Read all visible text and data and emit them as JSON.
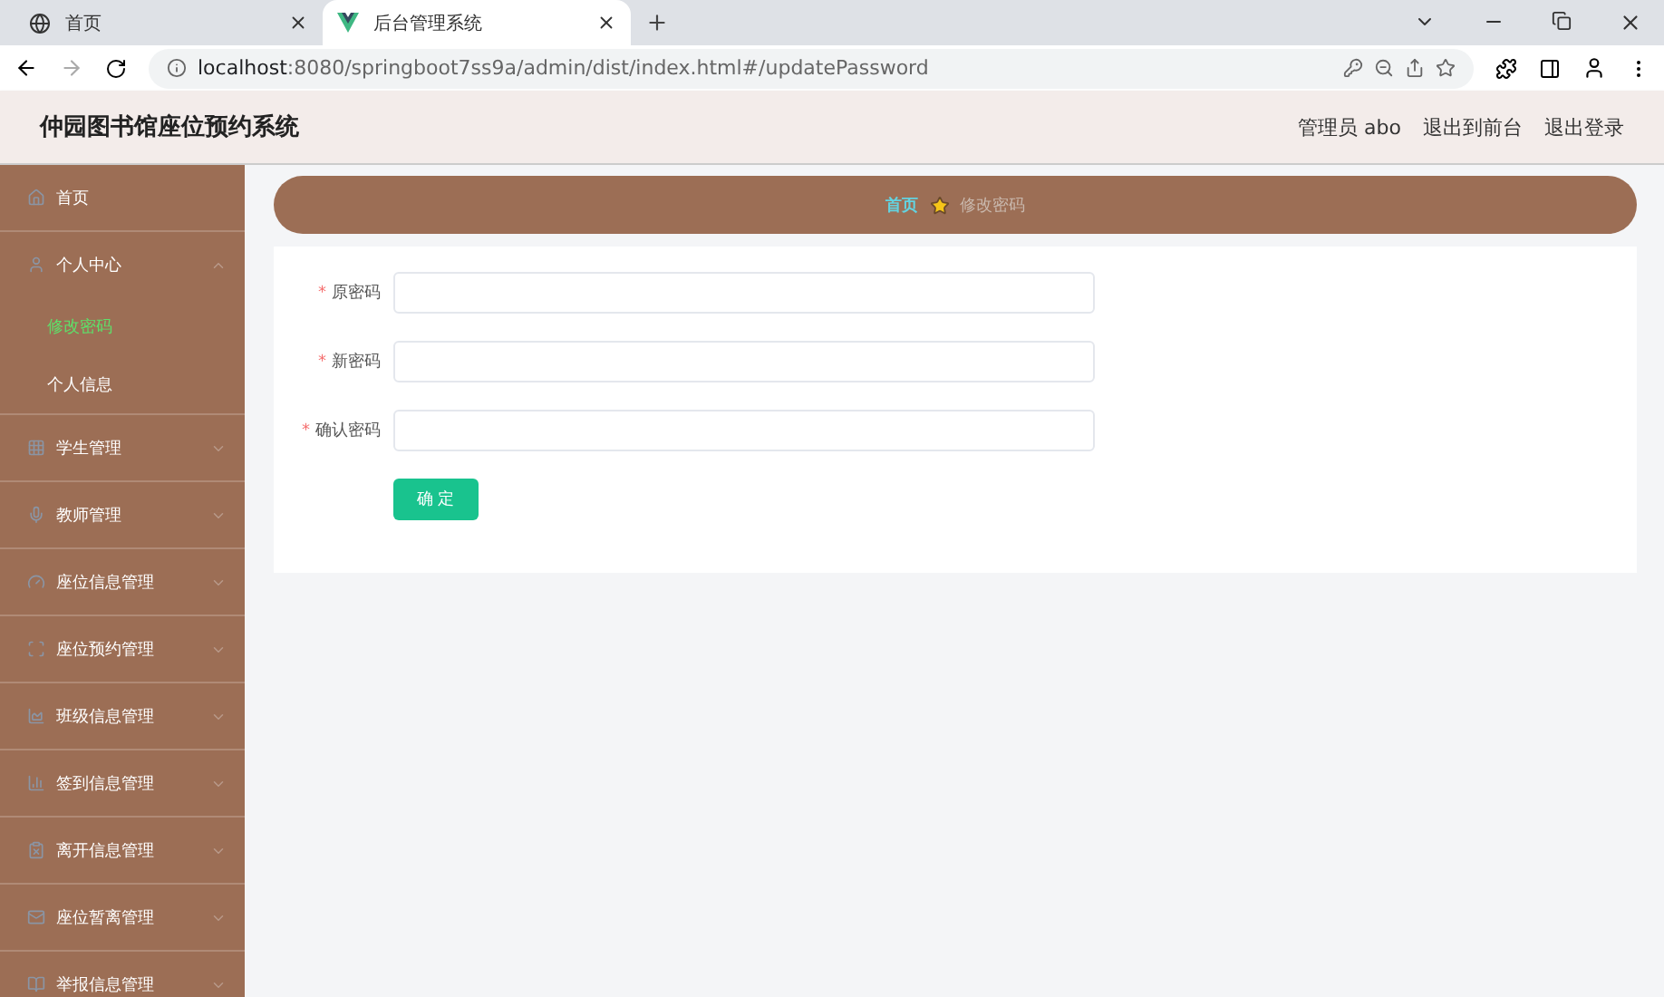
{
  "browser": {
    "tabs": [
      {
        "title": "首页",
        "selected": false
      },
      {
        "title": "后台管理系统",
        "selected": true
      }
    ],
    "url_host": "localhost",
    "url_rest": ":8080/springboot7ss9a/admin/dist/index.html#/updatePassword"
  },
  "header": {
    "title": "仲园图书馆座位预约系统",
    "links": [
      "管理员 abo",
      "退出到前台",
      "退出登录"
    ]
  },
  "sidebar": {
    "items": [
      {
        "label": "首页",
        "kind": "link"
      },
      {
        "label": "个人中心",
        "kind": "group",
        "expanded": true,
        "children": [
          {
            "label": "修改密码",
            "selected": true
          },
          {
            "label": "个人信息",
            "selected": false
          }
        ]
      },
      {
        "label": "学生管理",
        "kind": "group",
        "expanded": false
      },
      {
        "label": "教师管理",
        "kind": "group",
        "expanded": false
      },
      {
        "label": "座位信息管理",
        "kind": "group",
        "expanded": false
      },
      {
        "label": "座位预约管理",
        "kind": "group",
        "expanded": false
      },
      {
        "label": "班级信息管理",
        "kind": "group",
        "expanded": false
      },
      {
        "label": "签到信息管理",
        "kind": "group",
        "expanded": false
      },
      {
        "label": "离开信息管理",
        "kind": "group",
        "expanded": false
      },
      {
        "label": "座位暂离管理",
        "kind": "group",
        "expanded": false
      },
      {
        "label": "举报信息管理",
        "kind": "group",
        "expanded": false
      }
    ]
  },
  "breadcrumb": [
    "首页",
    "修改密码"
  ],
  "form": {
    "fields": [
      {
        "label": "原密码",
        "required_mark": "*"
      },
      {
        "label": "新密码",
        "required_mark": "*"
      },
      {
        "label": "确认密码",
        "required_mark": "*"
      }
    ],
    "submit": "确 定"
  }
}
